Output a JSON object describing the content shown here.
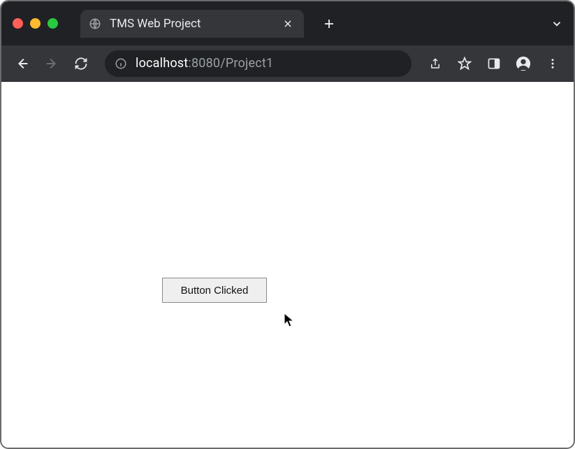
{
  "browser": {
    "tab_title": "TMS Web Project",
    "url_host": "localhost",
    "url_port_path": ":8080/Project1"
  },
  "page": {
    "button_label": "Button Clicked"
  }
}
